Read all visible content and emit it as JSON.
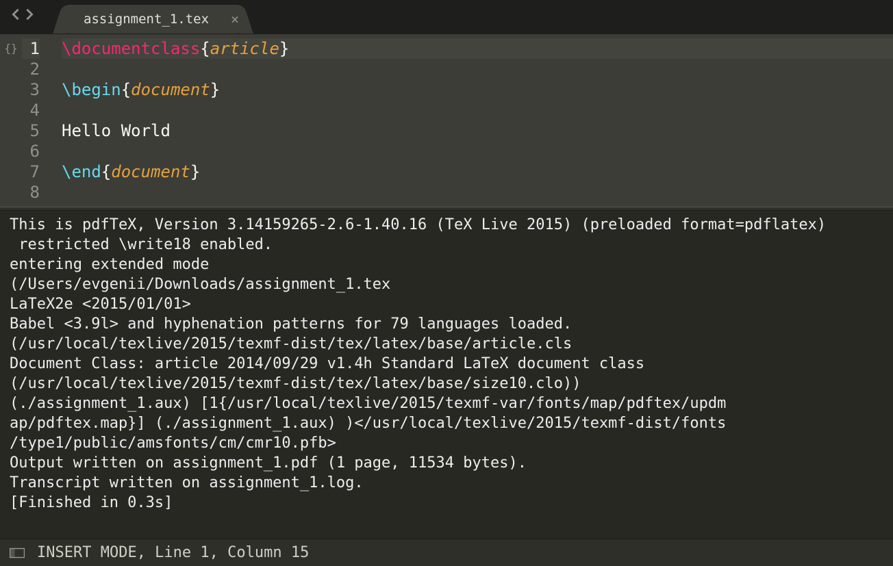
{
  "tab": {
    "filename": "assignment_1.tex",
    "close_glyph": "×"
  },
  "sidebar": {
    "fold_glyph": "{}"
  },
  "editor": {
    "current_line": 1,
    "lines": [
      {
        "num": 1,
        "tokens": [
          {
            "cls": "tok-cmd",
            "text": "\\documentclass"
          },
          {
            "cls": "tok-brace",
            "text": "{"
          },
          {
            "cls": "tok-arg",
            "text": "article"
          },
          {
            "cls": "tok-brace",
            "text": "}"
          }
        ]
      },
      {
        "num": 2,
        "tokens": []
      },
      {
        "num": 3,
        "tokens": [
          {
            "cls": "tok-kw",
            "text": "\\begin"
          },
          {
            "cls": "tok-brace",
            "text": "{"
          },
          {
            "cls": "tok-arg",
            "text": "document"
          },
          {
            "cls": "tok-brace",
            "text": "}"
          }
        ]
      },
      {
        "num": 4,
        "tokens": []
      },
      {
        "num": 5,
        "tokens": [
          {
            "cls": "tok-plain",
            "text": "Hello World"
          }
        ]
      },
      {
        "num": 6,
        "tokens": []
      },
      {
        "num": 7,
        "tokens": [
          {
            "cls": "tok-kw",
            "text": "\\end"
          },
          {
            "cls": "tok-brace",
            "text": "{"
          },
          {
            "cls": "tok-arg",
            "text": "document"
          },
          {
            "cls": "tok-brace",
            "text": "}"
          }
        ]
      },
      {
        "num": 8,
        "tokens": []
      }
    ]
  },
  "output_lines": [
    "This is pdfTeX, Version 3.14159265-2.6-1.40.16 (TeX Live 2015) (preloaded format=pdflatex)",
    " restricted \\write18 enabled.",
    "entering extended mode",
    "(/Users/evgenii/Downloads/assignment_1.tex",
    "LaTeX2e <2015/01/01>",
    "Babel <3.9l> and hyphenation patterns for 79 languages loaded.",
    "(/usr/local/texlive/2015/texmf-dist/tex/latex/base/article.cls",
    "Document Class: article 2014/09/29 v1.4h Standard LaTeX document class",
    "(/usr/local/texlive/2015/texmf-dist/tex/latex/base/size10.clo))",
    "(./assignment_1.aux) [1{/usr/local/texlive/2015/texmf-var/fonts/map/pdftex/updm",
    "ap/pdftex.map}] (./assignment_1.aux) )</usr/local/texlive/2015/texmf-dist/fonts",
    "/type1/public/amsfonts/cm/cmr10.pfb>",
    "Output written on assignment_1.pdf (1 page, 11534 bytes).",
    "Transcript written on assignment_1.log.",
    "[Finished in 0.3s]"
  ],
  "status": {
    "text": "INSERT MODE, Line 1, Column 15"
  }
}
